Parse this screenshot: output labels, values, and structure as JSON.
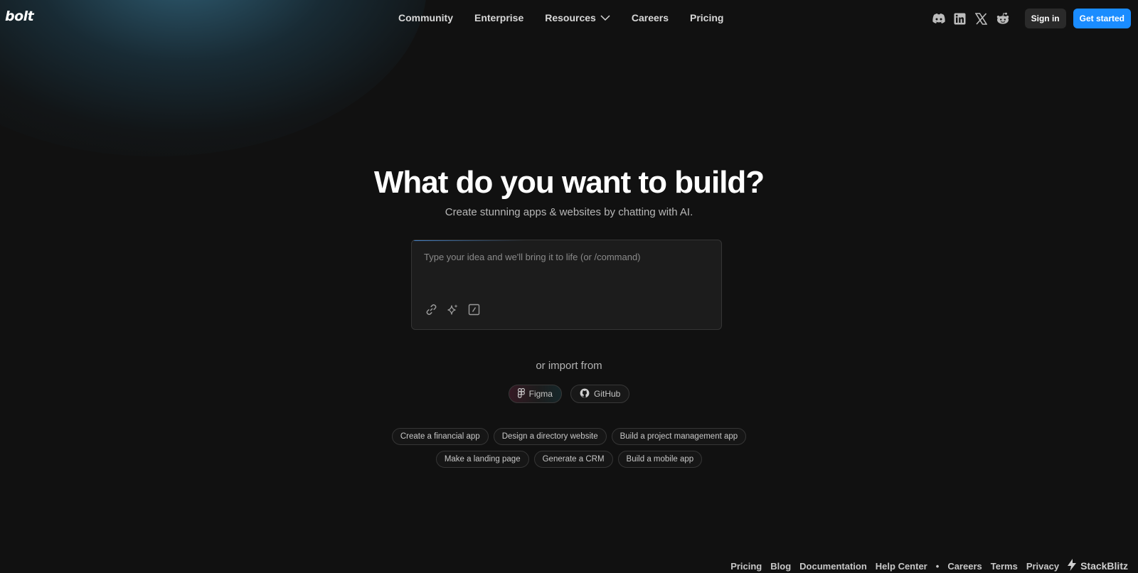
{
  "header": {
    "logo": "bolt",
    "nav": [
      {
        "label": "Community"
      },
      {
        "label": "Enterprise"
      },
      {
        "label": "Resources"
      },
      {
        "label": "Careers"
      },
      {
        "label": "Pricing"
      }
    ],
    "social_icons": [
      "discord-icon",
      "linkedin-icon",
      "x-icon",
      "reddit-icon"
    ],
    "signin_label": "Sign in",
    "get_started_label": "Get started"
  },
  "hero": {
    "title": "What do you want to build?",
    "subtitle": "Create stunning apps & websites by chatting with AI."
  },
  "prompt": {
    "placeholder": "Type your idea and we'll bring it to life (or /command)",
    "value": "",
    "tools": [
      "link-icon",
      "sparkle-icon",
      "command-icon"
    ]
  },
  "import": {
    "label": "or import from",
    "options": [
      {
        "label": "Figma",
        "icon": "figma-icon"
      },
      {
        "label": "GitHub",
        "icon": "github-icon"
      }
    ]
  },
  "suggestions": {
    "row1": [
      "Create a financial app",
      "Design a directory website",
      "Build a project management app"
    ],
    "row2": [
      "Make a landing page",
      "Generate a CRM",
      "Build a mobile app"
    ]
  },
  "footer": {
    "links": [
      "Pricing",
      "Blog",
      "Documentation",
      "Help Center",
      "Careers",
      "Terms",
      "Privacy"
    ],
    "separator": "•",
    "brand": "StackBlitz"
  },
  "colors": {
    "background": "#111111",
    "accent": "#1a8cff",
    "glow": "#489cc4"
  }
}
